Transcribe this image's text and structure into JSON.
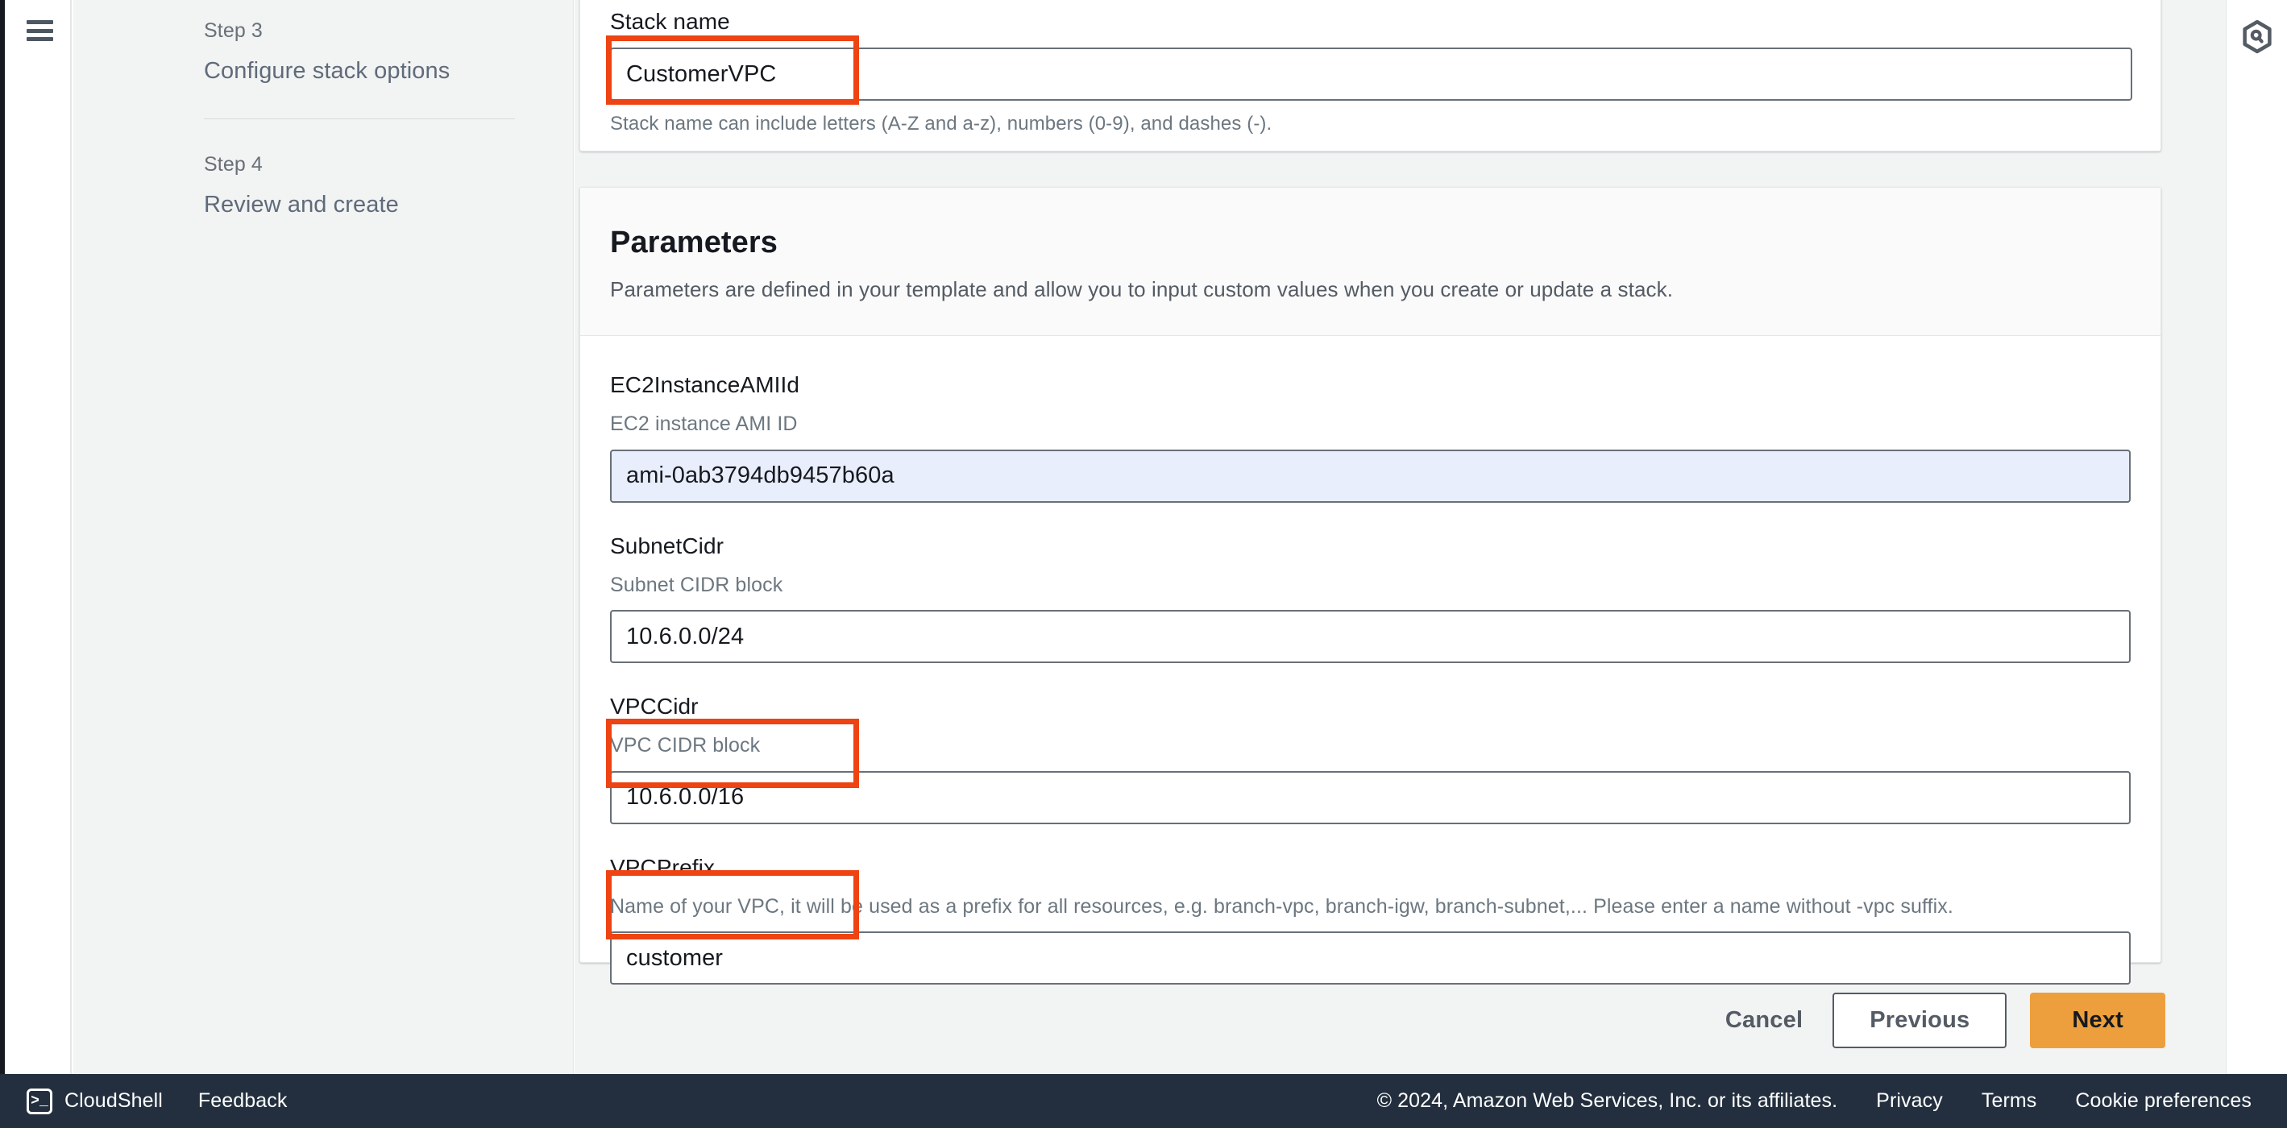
{
  "sidebar": {
    "steps": [
      {
        "kicker": "Step 3",
        "title": "Configure stack options"
      },
      {
        "kicker": "Step 4",
        "title": "Review and create"
      }
    ]
  },
  "stack_name_card": {
    "label": "Stack name",
    "value": "CustomerVPC",
    "hint": "Stack name can include letters (A-Z and a-z), numbers (0-9), and dashes (-)."
  },
  "parameters_card": {
    "title": "Parameters",
    "subtitle": "Parameters are defined in your template and allow you to input custom values when you create or update a stack.",
    "fields": [
      {
        "label": "EC2InstanceAMIId",
        "description": "EC2 instance AMI ID",
        "value": "ami-0ab3794db9457b60a"
      },
      {
        "label": "SubnetCidr",
        "description": "Subnet CIDR block",
        "value": "10.6.0.0/24"
      },
      {
        "label": "VPCCidr",
        "description": "VPC CIDR block",
        "value": "10.6.0.0/16"
      },
      {
        "label": "VPCPrefix",
        "description": "Name of your VPC, it will be used as a prefix for all resources, e.g. branch-vpc, branch-igw, branch-subnet,... Please enter a name without -vpc suffix.",
        "value": "customer"
      }
    ]
  },
  "actions": {
    "cancel": "Cancel",
    "previous": "Previous",
    "next": "Next"
  },
  "footer": {
    "cloudshell": "CloudShell",
    "cloudshell_glyph": ">_",
    "feedback": "Feedback",
    "copyright": "© 2024, Amazon Web Services, Inc. or its affiliates.",
    "privacy": "Privacy",
    "terms": "Terms",
    "cookie_preferences": "Cookie preferences"
  },
  "colors": {
    "annotation": "#ee4312",
    "primary_button": "#ec9f3c",
    "autofill_field": "#e8eefb",
    "footer_bar": "#232f3e"
  }
}
